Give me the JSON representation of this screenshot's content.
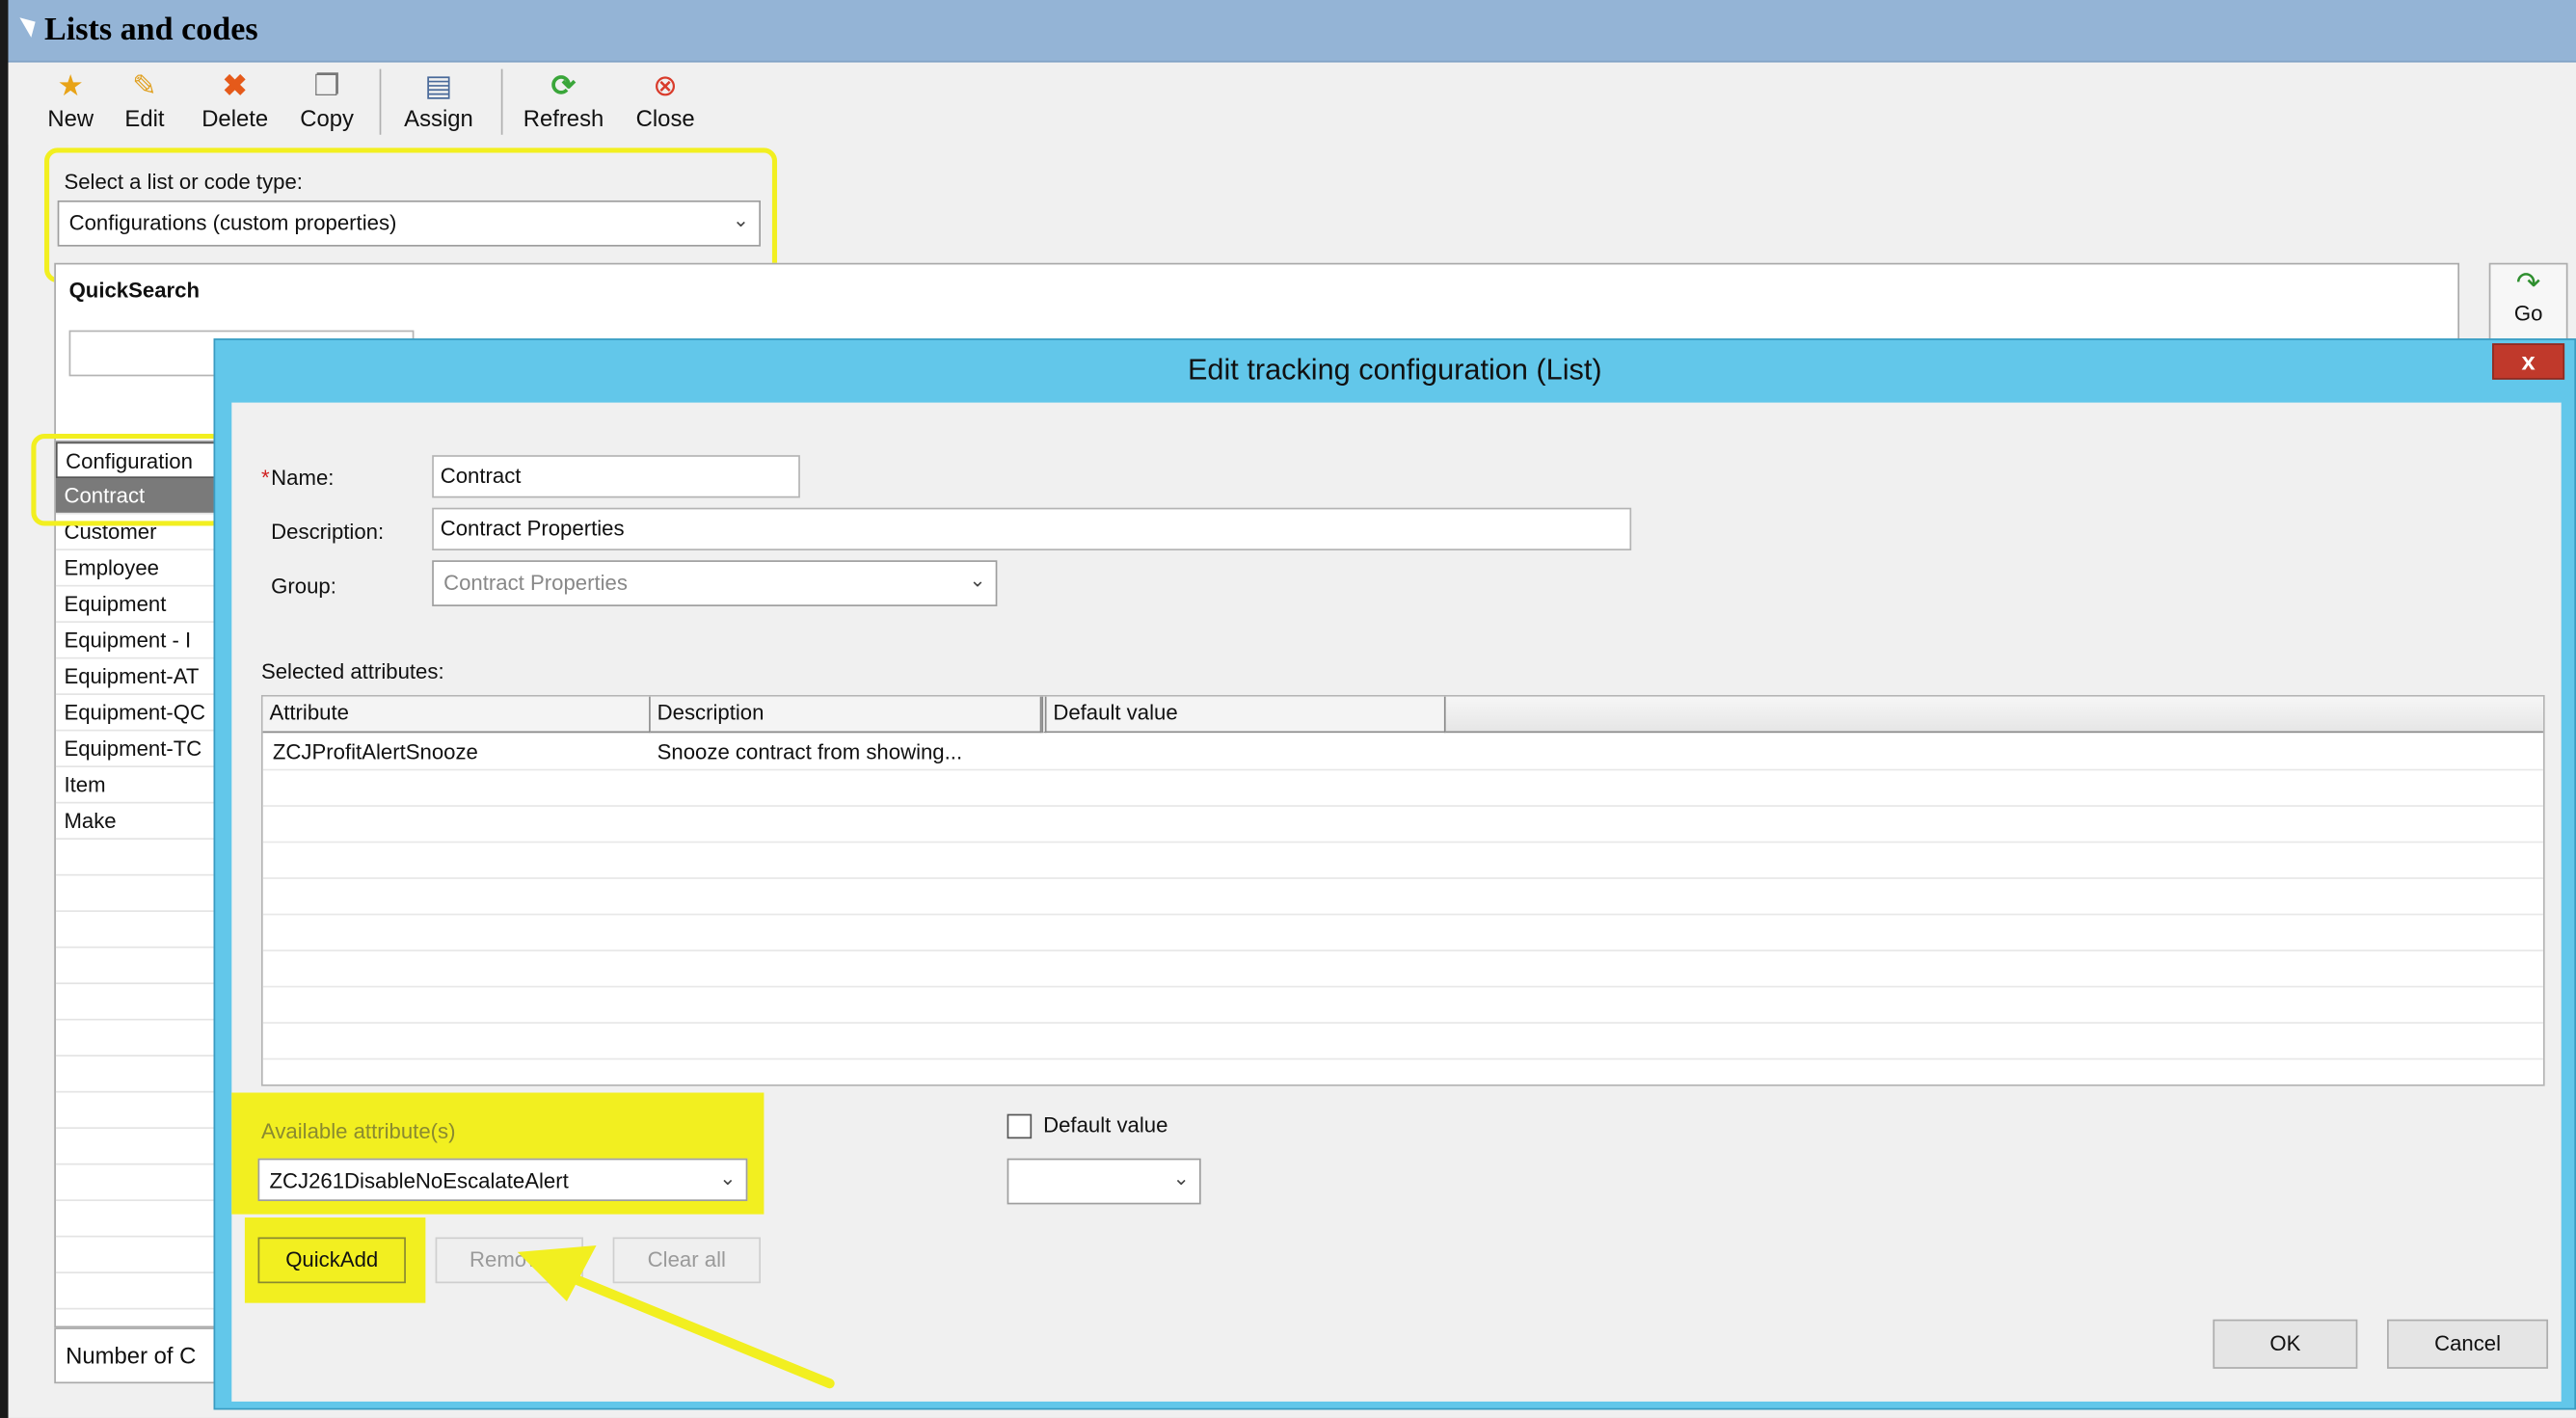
{
  "window": {
    "title": "Lists and codes"
  },
  "toolbar": {
    "new": "New",
    "edit": "Edit",
    "delete": "Delete",
    "copy": "Copy",
    "assign": "Assign",
    "refresh": "Refresh",
    "close": "Close"
  },
  "list_type": {
    "label": "Select a list or code type:",
    "value": "Configurations (custom properties)"
  },
  "quicksearch": {
    "title": "QuickSearch",
    "go": "Go"
  },
  "left_list": {
    "header": "Configuration",
    "items": [
      "Contract",
      "Customer",
      "Employee",
      "Equipment",
      "Equipment - I",
      "Equipment-AT",
      "Equipment-QC",
      "Equipment-TC",
      "Item",
      "Make"
    ],
    "selected": "Contract",
    "status": "Number of C"
  },
  "dialog": {
    "title": "Edit tracking configuration (List)",
    "close": "x",
    "name_label": "Name:",
    "required_mark": "*",
    "name_value": "Contract",
    "description_label": "Description:",
    "description_value": "Contract Properties",
    "group_label": "Group:",
    "group_value": "Contract Properties",
    "selected_attributes_label": "Selected attributes:",
    "columns": [
      "Attribute",
      "Description",
      "Default value"
    ],
    "rows": [
      {
        "attribute": "ZCJProfitAlertSnooze",
        "description": "Snooze contract from showing..."
      }
    ],
    "available_label": "Available attribute(s)",
    "available_value": "ZCJ261DisableNoEscalateAlert",
    "default_value_label": "Default value",
    "quickadd": "QuickAdd",
    "remove": "Remove",
    "clear_all": "Clear all",
    "ok": "OK",
    "cancel": "Cancel"
  },
  "colors": {
    "highlight": "#f2ef20",
    "dialog_frame": "#62c7ea",
    "title_bar": "#94b4d6"
  }
}
